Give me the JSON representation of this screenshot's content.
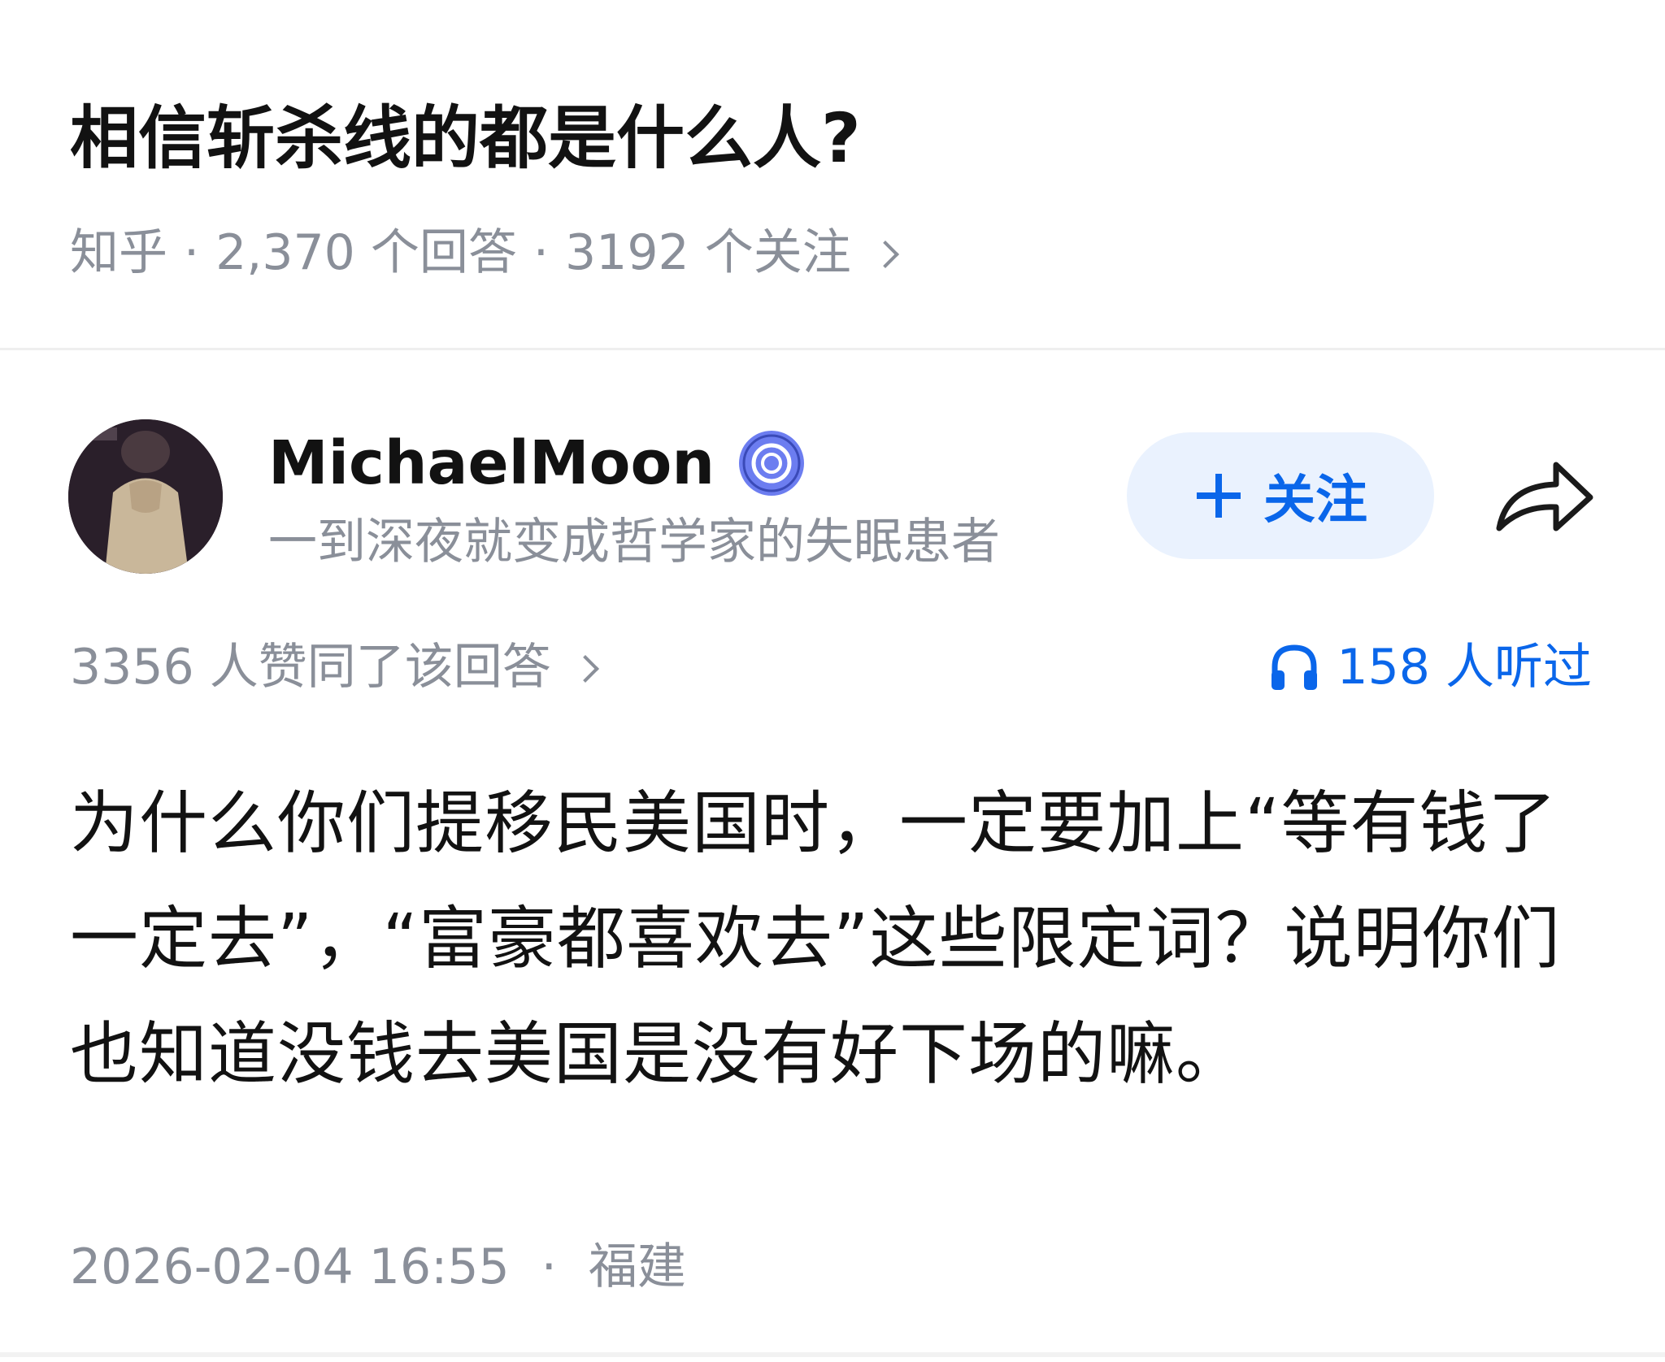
{
  "question": {
    "title": "相信斩杀线的都是什么人?",
    "source": "知乎",
    "answer_count": "2,370 个回答",
    "follow_count": "3192 个关注",
    "separator": "·"
  },
  "answer": {
    "author": {
      "name": "MichaelMoon",
      "bio": "一到深夜就变成哲学家的失眠患者",
      "badge_icon": "verified-badge-icon"
    },
    "follow_button": {
      "label": "关注"
    },
    "upvote_summary": "3356 人赞同了该回答",
    "listen_count": "158 人听过",
    "content": "为什么你们提移民美国时，一定要加上“等有钱了一定去”，“富豪都喜欢去”这些限定词？说明你们也知道没钱去美国是没有好下场的嘛。",
    "timestamp": "2026-02-04 16:55",
    "location": "福建",
    "separator": "·"
  },
  "colors": {
    "accent": "#0a66ea",
    "follow_bg": "#eaf2fe",
    "secondary_text": "#8a8f99",
    "primary_text": "#121212"
  }
}
